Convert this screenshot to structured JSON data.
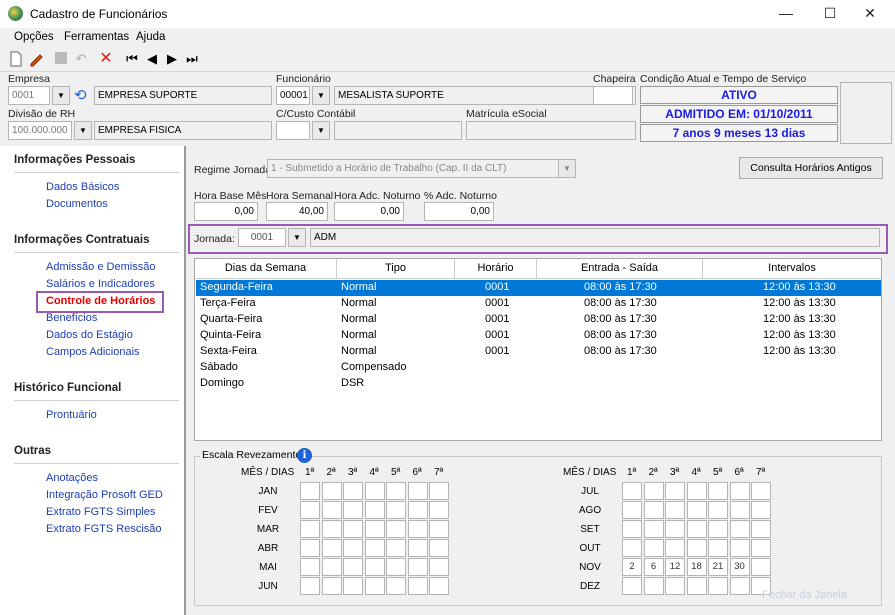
{
  "window": {
    "title": "Cadastro de Funcionários",
    "minimize": "—",
    "maximize": "☐",
    "close": "✕"
  },
  "menu": [
    "Opções",
    "Ferramentas",
    "Ajuda"
  ],
  "header": {
    "empresa_label": "Empresa",
    "empresa_code": "0001",
    "empresa_name": "EMPRESA SUPORTE",
    "funcionario_label": "Funcionário",
    "funcionario_code": "00001",
    "funcionario_name": "MESALISTA SUPORTE",
    "chapeira_label": "Chapeira",
    "chapeira_value": "",
    "condicao_label": "Condição Atual e Tempo de Serviço",
    "status": "ATIVO",
    "admitido": "ADMITIDO EM: 01/10/2011",
    "tempo": "7 anos 9 meses 13 dias",
    "divisao_label": "Divisão de RH",
    "divisao_code": "100.000.000",
    "divisao_name": "EMPRESA FISICA",
    "custo_label": "C/Custo Contábil",
    "custo_code": "",
    "custo_name": "",
    "matricula_label": "Matrícula eSocial",
    "matricula_value": ""
  },
  "sidebar": {
    "sections": [
      {
        "title": "Informações Pessoais",
        "items": [
          "Dados Básicos",
          "Documentos"
        ]
      },
      {
        "title": "Informações Contratuais",
        "items": [
          "Admissão e Demissão",
          "Salários e Indicadores",
          "Controle de Horários",
          "Benefícios",
          "Dados do Estágio",
          "Campos Adicionais"
        ]
      },
      {
        "title": "Histórico Funcional",
        "items": [
          "Prontuário"
        ]
      },
      {
        "title": "Outras",
        "items": [
          "Anotações",
          "Integração Prosoft GED",
          "Extrato FGTS Simples",
          "Extrato FGTS Rescisão"
        ]
      }
    ],
    "active": "Controle de Horários"
  },
  "main": {
    "regime_label": "Regime Jornada",
    "regime_value": "1 - Submetido a Horário de Trabalho (Cap. II da CLT)",
    "consulta_button": "Consulta Horários Antigos",
    "hora_base_label": "Hora Base Mês",
    "hora_base": "0,00",
    "hora_semanal_label": "Hora Semanal",
    "hora_semanal": "40,00",
    "hora_adc_label": "Hora Adc. Noturno",
    "hora_adc": "0,00",
    "pct_adc_label": "% Adc. Noturno",
    "pct_adc": "0,00",
    "jornada_label": "Jornada:",
    "jornada_code": "0001",
    "jornada_name": "ADM"
  },
  "table": {
    "columns": [
      "Dias da Semana",
      "Tipo",
      "Horário",
      "Entrada - Saída",
      "Intervalos"
    ],
    "rows": [
      [
        "Segunda-Feira",
        "Normal",
        "0001",
        "08:00 às 17:30",
        "12:00 às 13:30"
      ],
      [
        "Terça-Feira",
        "Normal",
        "0001",
        "08:00 às 17:30",
        "12:00 às 13:30"
      ],
      [
        "Quarta-Feira",
        "Normal",
        "0001",
        "08:00 às 17:30",
        "12:00 às 13:30"
      ],
      [
        "Quinta-Feira",
        "Normal",
        "0001",
        "08:00 às 17:30",
        "12:00 às 13:30"
      ],
      [
        "Sexta-Feira",
        "Normal",
        "0001",
        "08:00 às 17:30",
        "12:00 às 13:30"
      ],
      [
        "Sábado",
        "Compensado",
        "",
        "",
        ""
      ],
      [
        "Domingo",
        "DSR",
        "",
        "",
        ""
      ]
    ]
  },
  "escala": {
    "title": "Escala Revezamento",
    "info_icon": "i",
    "mes_dias": "MÊS / DIAS",
    "weeks": [
      "1ª",
      "2ª",
      "3ª",
      "4ª",
      "5ª",
      "6ª",
      "7ª"
    ],
    "months_left": [
      "JAN",
      "FEV",
      "MAR",
      "ABR",
      "MAI",
      "JUN"
    ],
    "months_right": [
      "JUL",
      "AGO",
      "SET",
      "OUT",
      "NOV",
      "DEZ"
    ],
    "nov_values": [
      "2",
      "6",
      "12",
      "18",
      "21",
      "30",
      ""
    ]
  },
  "footer": {
    "faded_button": "Fechar da Janela"
  },
  "colors": {
    "accent": "#0078d7",
    "link": "#1c3fb5",
    "active": "#e00000",
    "highlight": "#9b59b6",
    "status": "#1a1ae6"
  },
  "icons": [
    "app-icon",
    "new-icon",
    "edit-icon",
    "save-icon",
    "undo-icon",
    "delete-icon",
    "first-icon",
    "prev-icon",
    "next-icon",
    "last-icon",
    "refresh-icon",
    "info-icon"
  ]
}
